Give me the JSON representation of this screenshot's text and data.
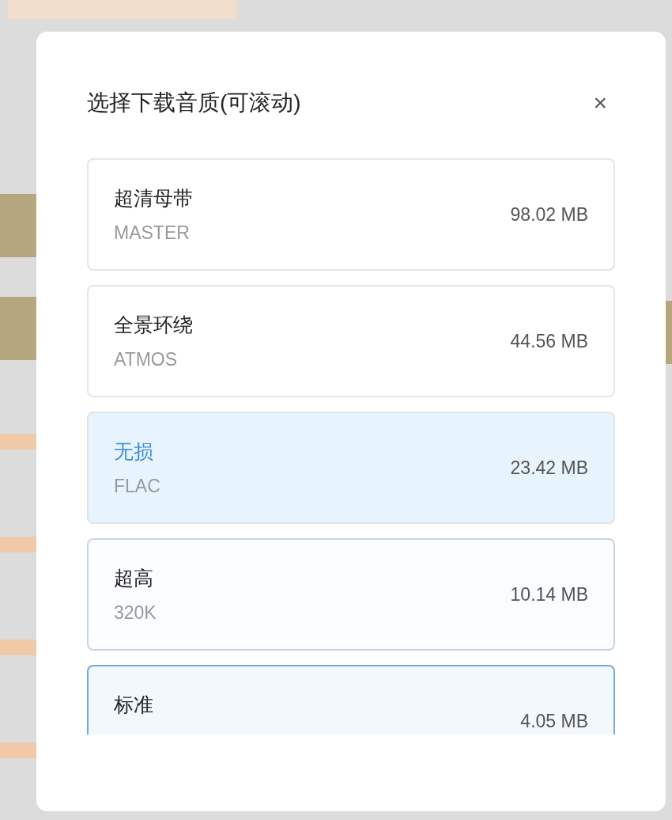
{
  "dialog": {
    "title": "选择下载音质(可滚动)",
    "close": "×"
  },
  "options": [
    {
      "name": "超清母带",
      "code": "MASTER",
      "size": "98.02 MB",
      "selected": false,
      "hovered": false,
      "focused": false
    },
    {
      "name": "全景环绕",
      "code": "ATMOS",
      "size": "44.56 MB",
      "selected": false,
      "hovered": false,
      "focused": false
    },
    {
      "name": "无损",
      "code": "FLAC",
      "size": "23.42 MB",
      "selected": true,
      "hovered": false,
      "focused": false
    },
    {
      "name": "超高",
      "code": "320K",
      "size": "10.14 MB",
      "selected": false,
      "hovered": true,
      "focused": false
    },
    {
      "name": "标准",
      "size": "4.05 MB",
      "selected": false,
      "hovered": false,
      "focused": true
    }
  ]
}
